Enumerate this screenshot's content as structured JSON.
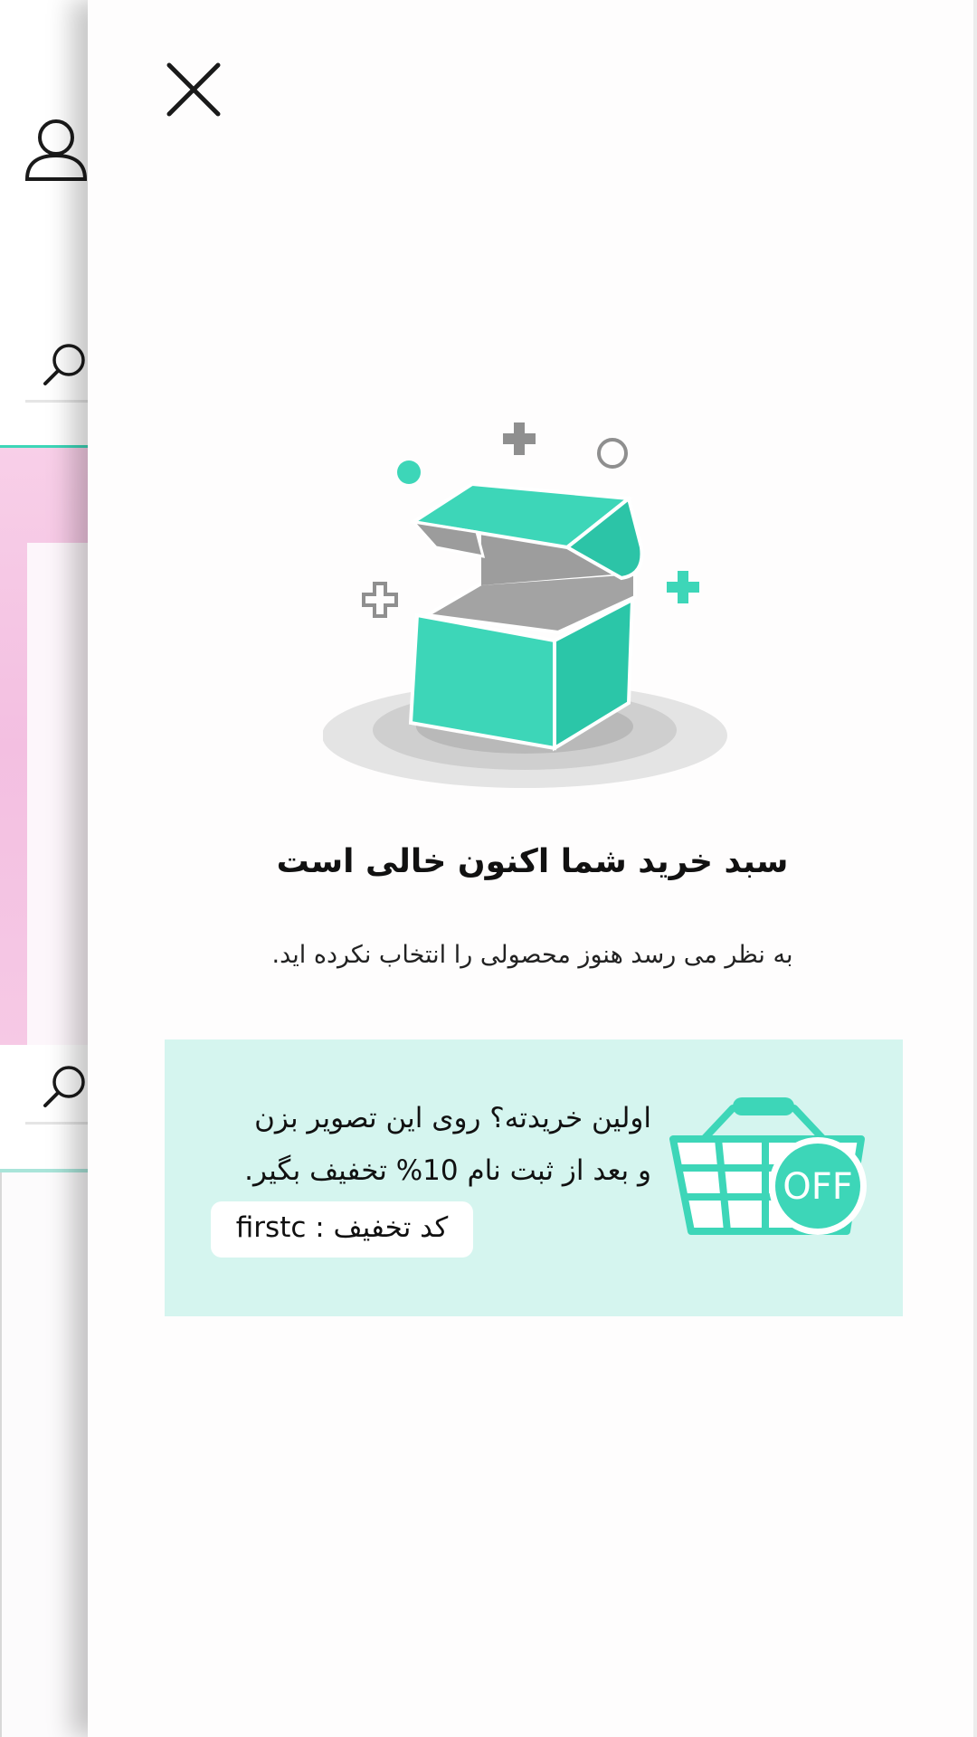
{
  "cart": {
    "empty_title": "سبد خرید شما اکنون خالی است",
    "empty_subtitle": "به نظر می رسد هنوز محصولی را انتخاب نکرده اید."
  },
  "promo": {
    "line1": "اولین خریدته؟ روی این تصویر بزن",
    "line2": "و بعد از ثبت نام 10% تخفیف بگیر.",
    "code_label": "کد تخفیف : firstc",
    "badge_text": "OFF"
  },
  "colors": {
    "accent": "#3dd6b8",
    "promo_bg": "#d5f5ef",
    "banner_pink": "#f3bfe1"
  },
  "icons": {
    "close": "close-icon",
    "user": "user-icon",
    "search": "search-icon",
    "empty_box": "empty-box-illustration",
    "basket": "shopping-basket-off-icon"
  }
}
